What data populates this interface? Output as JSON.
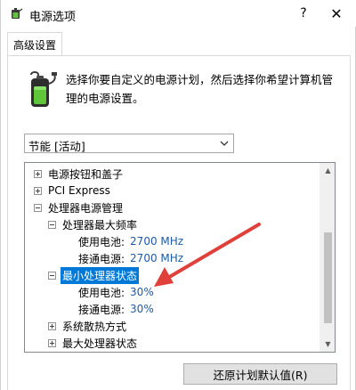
{
  "window": {
    "title": "电源选项",
    "help_glyph": "?",
    "close_glyph": "✕"
  },
  "tabs": [
    {
      "label": "高级设置"
    }
  ],
  "intro": {
    "text": "选择你要自定义的电源计划，然后选择你希望计算机管理的电源设置。"
  },
  "plan_select": {
    "value": "节能 [活动]"
  },
  "tree": {
    "items": [
      {
        "label": "电源按钮和盖子",
        "expander": "+"
      },
      {
        "label": "PCI Express",
        "expander": "+"
      },
      {
        "label": "处理器电源管理",
        "expander": "−"
      },
      {
        "label": "处理器最大频率",
        "expander": "−"
      },
      {
        "label": "使用电池:",
        "value": "2700 MHz"
      },
      {
        "label": "接通电源:",
        "value": "2700 MHz"
      },
      {
        "label": "最小处理器状态",
        "expander": "−",
        "selected": true
      },
      {
        "label": "使用电池:",
        "value": "30%"
      },
      {
        "label": "接通电源:",
        "value": "30%"
      },
      {
        "label": "系统散热方式",
        "expander": "+"
      },
      {
        "label": "最大处理器状态",
        "expander": "+"
      }
    ],
    "scroll_up_glyph": "▲",
    "scroll_down_glyph": "▼"
  },
  "buttons": {
    "restore_defaults": "还原计划默认值(R)"
  },
  "colors": {
    "selection": "#0078d7",
    "value_text": "#1e5aa8",
    "annotation_arrow": "#e0403a"
  },
  "icons": {
    "app": "power-options-icon",
    "battery": "battery-plug-icon",
    "dropdown": "chevron-down-icon"
  }
}
